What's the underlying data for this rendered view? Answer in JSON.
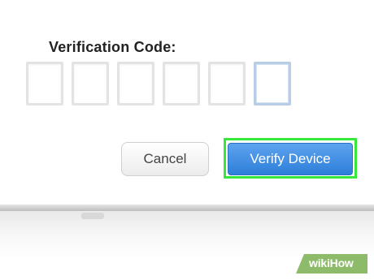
{
  "dialog": {
    "label": "Verification Code:",
    "code_boxes": [
      "",
      "",
      "",
      "",
      "",
      ""
    ],
    "active_box_index": 5,
    "cancel_label": "Cancel",
    "verify_label": "Verify Device",
    "highlight_color": "#35e83a",
    "accent_color": "#3a8ae3"
  },
  "watermark": {
    "text": "wikiHow",
    "color": "#8dbb6a"
  }
}
